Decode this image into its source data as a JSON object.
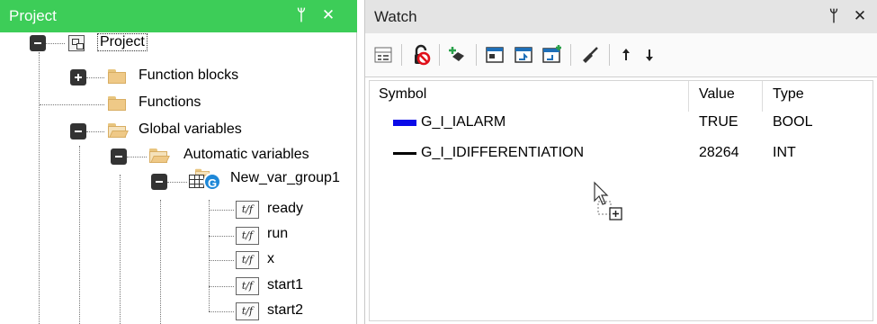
{
  "left_panel": {
    "title": "Project",
    "pin_icon": "pin-icon",
    "close_icon": "close-icon",
    "tree": {
      "root": "Project",
      "function_blocks": "Function blocks",
      "functions": "Functions",
      "global_variables": "Global variables",
      "automatic_variables": "Automatic variables",
      "var_group": "New_var_group1",
      "var_icon_text": "t/f",
      "variables": [
        "ready",
        "run",
        "x",
        "start1",
        "start2"
      ]
    }
  },
  "right_panel": {
    "title": "Watch",
    "pin_icon": "pin-icon",
    "close_icon": "close-icon",
    "toolbar_icons": [
      "watch-list-icon",
      "unlock-icon",
      "add-variable-icon",
      "window-icon",
      "import-icon",
      "export-icon",
      "clear-icon",
      "move-up-icon",
      "move-down-icon"
    ],
    "columns": [
      "Symbol",
      "Value",
      "Type"
    ],
    "rows": [
      {
        "symbol": "G_I_IALARM",
        "value": "TRUE",
        "type": "BOOL",
        "color": "#0a0ae8"
      },
      {
        "symbol": "G_I_IDIFFERENTIATION",
        "value": "28264",
        "type": "INT",
        "color": "#000000"
      }
    ]
  },
  "colors": {
    "accent": "#3dcd58",
    "header_grey": "#e4e4e4"
  }
}
